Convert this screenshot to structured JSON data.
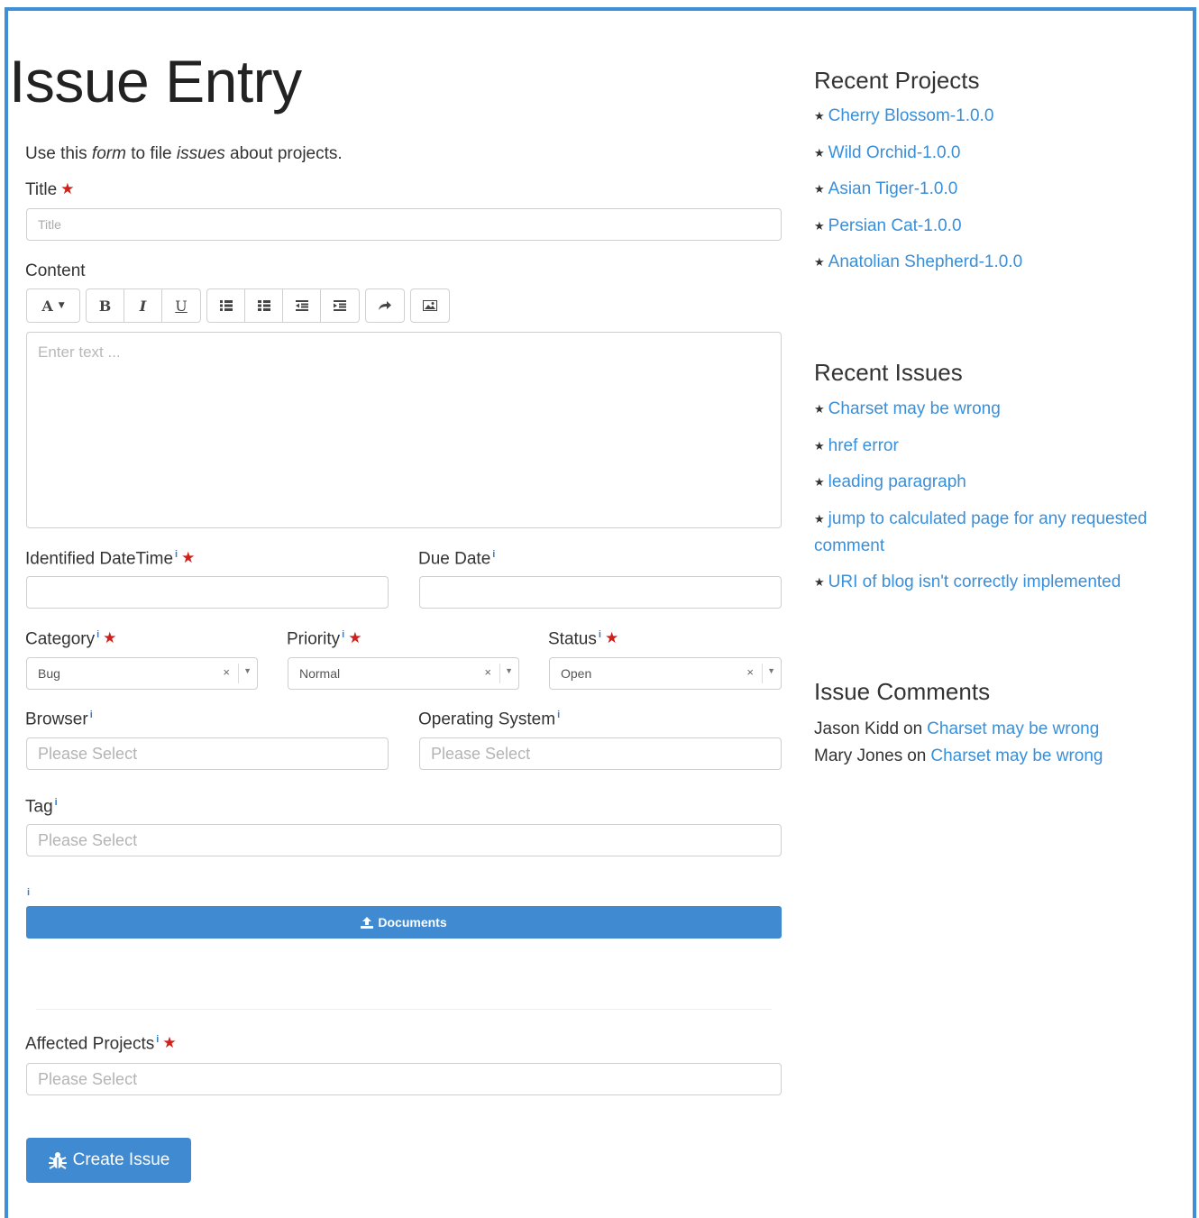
{
  "page": {
    "title": "Issue Entry",
    "intro": {
      "part1": "Use this ",
      "em1": "form",
      "part2": " to file ",
      "em2": "issues",
      "part3": " about projects."
    }
  },
  "form": {
    "title_label": "Title",
    "title_placeholder": "Title",
    "content_label": "Content",
    "editor_placeholder": "Enter text ...",
    "toolbar": {
      "font": "A",
      "bold": "B",
      "italic": "I",
      "underline": "U"
    },
    "identified_label": "Identified DateTime",
    "due_label": "Due Date",
    "category_label": "Category",
    "category_value": "Bug",
    "priority_label": "Priority",
    "priority_value": "Normal",
    "status_label": "Status",
    "status_value": "Open",
    "browser_label": "Browser",
    "browser_placeholder": "Please Select",
    "os_label": "Operating System",
    "os_placeholder": "Please Select",
    "tag_label": "Tag",
    "tag_placeholder": "Please Select",
    "documents_label": "Documents",
    "affected_label": "Affected Projects",
    "affected_placeholder": "Please Select",
    "create_label": "Create Issue",
    "required_mark": "★",
    "info_mark": "i"
  },
  "sidebar": {
    "recent_projects_title": "Recent Projects",
    "recent_projects": [
      "Cherry Blossom-1.0.0",
      "Wild Orchid-1.0.0",
      "Asian Tiger-1.0.0",
      "Persian Cat-1.0.0",
      "Anatolian Shepherd-1.0.0"
    ],
    "recent_issues_title": "Recent Issues",
    "recent_issues": [
      "Charset may be wrong",
      "href error",
      "leading paragraph",
      "jump to calculated page for any requested comment",
      "URI of blog isn't correctly implemented"
    ],
    "comments_title": "Issue Comments",
    "comments": [
      {
        "user": "Jason Kidd",
        "on": "on",
        "issue": "Charset may be wrong"
      },
      {
        "user": "Mary Jones",
        "on": "on",
        "issue": "Charset may be wrong"
      }
    ]
  },
  "colors": {
    "accent": "#3f8ad0",
    "link": "#3a8fd9",
    "required": "#d0201c",
    "frame": "#3f8fd8"
  }
}
